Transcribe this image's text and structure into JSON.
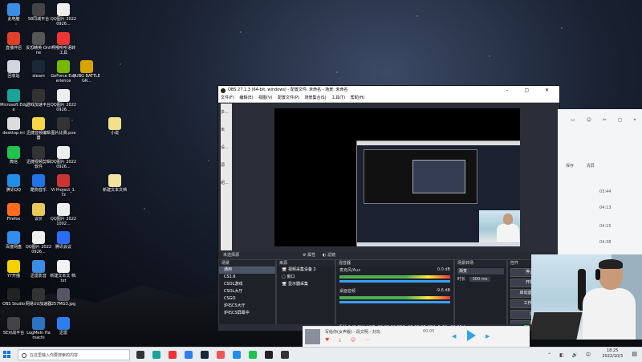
{
  "desktop": {
    "icons": [
      {
        "label": "此电脑",
        "color": "#3a8ee6"
      },
      {
        "label": "58同城平台",
        "color": "#444"
      },
      {
        "label": "QQ图片 20220926...",
        "color": "#eee"
      },
      {
        "label": "直播伴侣",
        "color": "#e0402a"
      },
      {
        "label": "反恐精英 Online",
        "color": "#555"
      },
      {
        "label": "啊哦听听语转 工具",
        "color": "#e33"
      },
      {
        "label": "回收站",
        "color": "#cfd6de"
      },
      {
        "label": "steam",
        "color": "#1b2838"
      },
      {
        "label": "GeForce Experience",
        "color": "#76b900"
      },
      {
        "label": "PUBG BATTLEGR...",
        "color": "#d9a400"
      },
      {
        "label": "Microsoft Edge",
        "color": "#1aa39b"
      },
      {
        "label": "游戏加速平台",
        "color": "#333"
      },
      {
        "label": "QQ图片 20220926...",
        "color": "#eee"
      },
      {
        "label": "desktop.ini",
        "color": "#dcdcdc"
      },
      {
        "label": "迅捷音频编辑器",
        "color": "#f8d549"
      },
      {
        "label": "图片比赛.pve",
        "color": "#333"
      },
      {
        "label": "小说",
        "color": "#f2e08a"
      },
      {
        "label": "微信",
        "color": "#20c34d"
      },
      {
        "label": "迅捷视频剪辑 软件",
        "color": "#333"
      },
      {
        "label": "QQ图片 20220926...",
        "color": "#eee"
      },
      {
        "label": "腾讯QQ",
        "color": "#1f8fe8"
      },
      {
        "label": "酷狗音乐",
        "color": "#2272e8"
      },
      {
        "label": "VI Project_1.7z",
        "color": "#c33"
      },
      {
        "label": "新建文本文档",
        "color": "#f0e4a0"
      },
      {
        "label": "Firefox",
        "color": "#ff6b1a"
      },
      {
        "label": "议价",
        "color": "#e8c95a"
      },
      {
        "label": "QQ图片 20221002...",
        "color": "#eee"
      },
      {
        "label": "百度网盘",
        "color": "#2f8ef0"
      },
      {
        "label": "QQ图片 20220926...",
        "color": "#eee"
      },
      {
        "label": "腾讯会议",
        "color": "#2a6cf5"
      },
      {
        "label": "YY开播",
        "color": "#f5d100"
      },
      {
        "label": "迅雷影音",
        "color": "#3a8ee6"
      },
      {
        "label": "新建文本文 档.txt",
        "color": "#f2f2f2"
      },
      {
        "label": "OBS Studio",
        "color": "#222"
      },
      {
        "label": "网易UU加速器",
        "color": "#333"
      },
      {
        "label": "257MG3.jpg",
        "color": "#556"
      },
      {
        "label": "5E对战平台",
        "color": "#444"
      },
      {
        "label": "LogMeIn Hamachi",
        "color": "#2b74c4"
      },
      {
        "label": "迅雷",
        "color": "#2f7ef0"
      }
    ]
  },
  "obs": {
    "title": "OBS 27.1.3 (64-bit, windows) - 配置文件: 未命名 - 场景: 未命名",
    "menu": [
      "文件(F)",
      "编辑(E)",
      "视图(V)",
      "配置文件(P)",
      "场景集合(S)",
      "工具(T)",
      "帮助(H)"
    ],
    "left_tabs": [
      "多...",
      "未设...",
      "源",
      "组..."
    ],
    "scene_label": "未选择源",
    "properties_btn": "属性",
    "filters_btn": "滤镜",
    "scenes_title": "场景",
    "scenes": [
      "通用",
      "CS1.6",
      "CSOL游戏",
      "CSOL大厅",
      "CSGO",
      "炉石CS大厅",
      "炉石CS屏幕中"
    ],
    "sources_title": "来源",
    "sources": [
      "视频采集设备 2",
      "窗口",
      "显示器采集"
    ],
    "mixer_title": "混音器",
    "mixer": [
      {
        "name": "麦克风/Aux",
        "db": "0.0 dB"
      },
      {
        "name": "桌面音频",
        "db": "-9.6 dB"
      }
    ],
    "transitions_title": "场景转场",
    "transition_value": "渐变",
    "duration_label": "时长",
    "duration_value": "300 ms",
    "controls_title": "控件",
    "controls": [
      "停止推流",
      "开始录制",
      "启动虚拟摄像机",
      "工作室模式",
      "设置",
      "退出"
    ],
    "status": "丢帧 0 (0.0%)   LIVE: 00:00:00   REC: 00:00:00   CPU: 5.4%, 60.00 fps"
  },
  "side_panel": {
    "header_items": [
      "保存",
      "清屏"
    ],
    "times": [
      "03:44",
      "04:13",
      "04:15",
      "04:38"
    ]
  },
  "player": {
    "title": "写给你(女声版) - 段文明 - 刘鸟",
    "time": "00:05"
  },
  "taskbar": {
    "search_placeholder": "在这里输入你要搜索的内容",
    "time": "18:25",
    "date": "2022/10/3",
    "icons": [
      {
        "name": "task-view",
        "color": "#333"
      },
      {
        "name": "edge",
        "color": "#1aa39b"
      },
      {
        "name": "chrome",
        "color": "#e33"
      },
      {
        "name": "media",
        "color": "#2f7ef0"
      },
      {
        "name": "steam",
        "color": "#1b2838"
      },
      {
        "name": "game",
        "color": "#e55"
      },
      {
        "name": "qq-browser",
        "color": "#1f8fe8"
      },
      {
        "name": "wechat",
        "color": "#20c34d"
      },
      {
        "name": "obs",
        "color": "#222"
      },
      {
        "name": "app",
        "color": "#333"
      }
    ]
  }
}
